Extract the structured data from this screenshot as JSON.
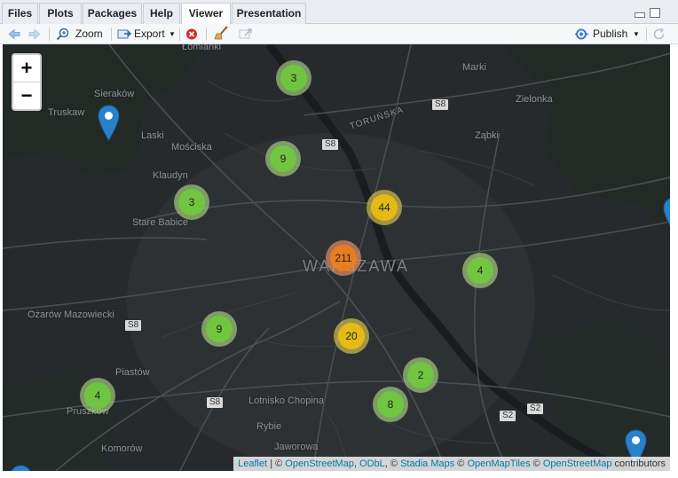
{
  "tabs": [
    {
      "label": "Files",
      "active": false
    },
    {
      "label": "Plots",
      "active": false
    },
    {
      "label": "Packages",
      "active": false
    },
    {
      "label": "Help",
      "active": false
    },
    {
      "label": "Viewer",
      "active": true
    },
    {
      "label": "Presentation",
      "active": false
    }
  ],
  "toolbar": {
    "zoom_label": "Zoom",
    "export_label": "Export",
    "publish_label": "Publish"
  },
  "map": {
    "zoom_in": "+",
    "zoom_out": "−",
    "places": [
      {
        "name": "Łomianki",
        "kind": "town"
      },
      {
        "name": "Marki",
        "kind": "town"
      },
      {
        "name": "Zielonka",
        "kind": "town"
      },
      {
        "name": "Sieraków",
        "kind": "town"
      },
      {
        "name": "Truskaw",
        "kind": "town"
      },
      {
        "name": "Laski",
        "kind": "town"
      },
      {
        "name": "Mościska",
        "kind": "town"
      },
      {
        "name": "Ząbki",
        "kind": "town"
      },
      {
        "name": "Klaudyn",
        "kind": "town"
      },
      {
        "name": "Stare Babice",
        "kind": "town"
      },
      {
        "name": "WARSZAWA",
        "kind": "city"
      },
      {
        "name": "Ożarów Mazowiecki",
        "kind": "town"
      },
      {
        "name": "Piastów",
        "kind": "town"
      },
      {
        "name": "Pruszków",
        "kind": "town"
      },
      {
        "name": "Lotnisko Chopina",
        "kind": "town"
      },
      {
        "name": "Rybie",
        "kind": "town"
      },
      {
        "name": "Jaworowa",
        "kind": "town"
      },
      {
        "name": "Komorów",
        "kind": "town"
      },
      {
        "name": "TORUŃSKA",
        "kind": "street"
      }
    ],
    "road_shields": [
      "S8",
      "S8",
      "S8",
      "S8",
      "S2",
      "S2"
    ],
    "clusters": [
      {
        "count": "3",
        "size": "small"
      },
      {
        "count": "9",
        "size": "small"
      },
      {
        "count": "3",
        "size": "small"
      },
      {
        "count": "44",
        "size": "medium"
      },
      {
        "count": "211",
        "size": "large"
      },
      {
        "count": "4",
        "size": "small"
      },
      {
        "count": "9",
        "size": "small"
      },
      {
        "count": "20",
        "size": "medium"
      },
      {
        "count": "2",
        "size": "small"
      },
      {
        "count": "8",
        "size": "small"
      },
      {
        "count": "4",
        "size": "small"
      }
    ],
    "attribution": {
      "leaflet": "Leaflet",
      "sep1": " | © ",
      "osm": "OpenStreetMap",
      "comma": ", ",
      "odbl": "ODbL",
      "sep2": ", © ",
      "stadia": "Stadia Maps",
      "sep3": " © ",
      "omt": "OpenMapTiles",
      "sep4": " © ",
      "osm2": "OpenStreetMap",
      "contributors": " contributors"
    }
  },
  "colors": {
    "map_bg": "#262a2d",
    "cluster_small": "#6ecc39",
    "cluster_medium": "#f0c20c",
    "cluster_large": "#f18017",
    "marker": "#2a81cb"
  }
}
